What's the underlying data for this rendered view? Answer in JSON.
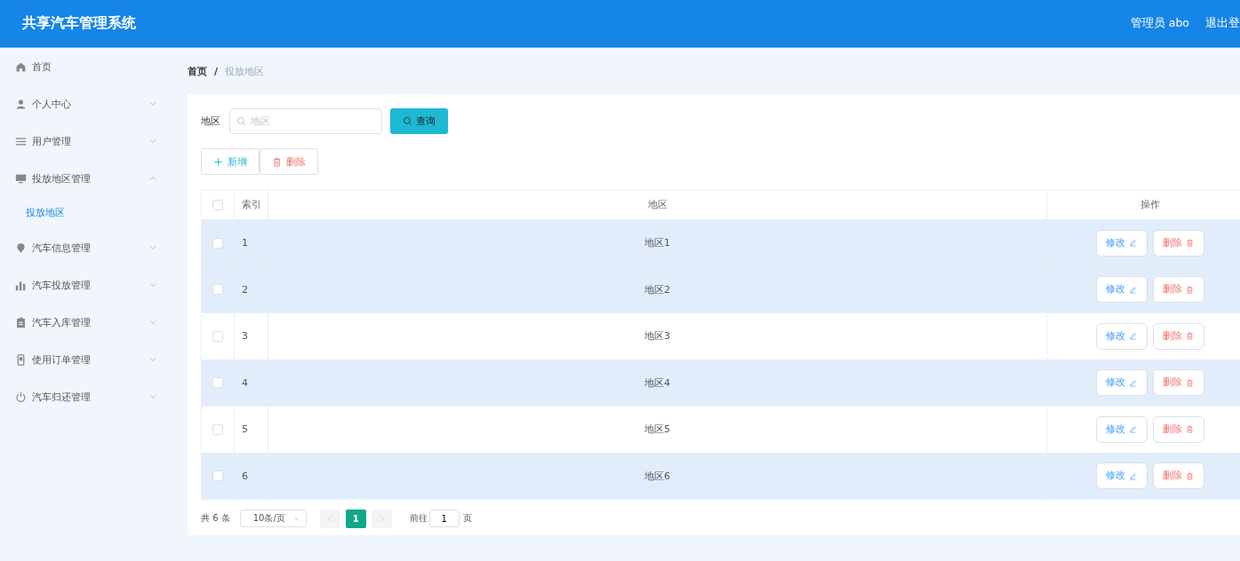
{
  "header": {
    "title": "共享汽车管理系统",
    "user": "管理员 abo",
    "logout": "退出登"
  },
  "sidebar": {
    "items": [
      {
        "label": "首页",
        "kind": "link"
      },
      {
        "label": "个人中心",
        "kind": "menu",
        "expanded": false
      },
      {
        "label": "用户管理",
        "kind": "menu",
        "expanded": false
      },
      {
        "label": "投放地区管理",
        "kind": "menu",
        "expanded": true,
        "children": [
          {
            "label": "投放地区",
            "selected": true
          }
        ]
      },
      {
        "label": "汽车信息管理",
        "kind": "menu",
        "expanded": false
      },
      {
        "label": "汽车投放管理",
        "kind": "menu",
        "expanded": false
      },
      {
        "label": "汽车入库管理",
        "kind": "menu",
        "expanded": false
      },
      {
        "label": "使用订单管理",
        "kind": "menu",
        "expanded": false
      },
      {
        "label": "汽车归还管理",
        "kind": "menu",
        "expanded": false
      }
    ]
  },
  "breadcrumb": {
    "separator": "/",
    "items": [
      "首页",
      "投放地区"
    ]
  },
  "search": {
    "label": "地区",
    "placeholder": "地区",
    "button": "查询"
  },
  "actions": [
    {
      "label": "新增",
      "kind": "add"
    },
    {
      "label": "删除",
      "kind": "delete"
    }
  ],
  "table": {
    "select_all_checked": false,
    "columns": [
      "索引",
      "地区",
      "操作"
    ],
    "rows": [
      {
        "index": "1",
        "region": "地区1",
        "checked": false,
        "highlighted": true,
        "actions": [
          {
            "label": "修改",
            "kind": "edit"
          },
          {
            "label": "删除",
            "kind": "delete"
          }
        ]
      },
      {
        "index": "2",
        "region": "地区2",
        "checked": false,
        "highlighted": true,
        "actions": [
          {
            "label": "修改",
            "kind": "edit"
          },
          {
            "label": "删除",
            "kind": "delete"
          }
        ]
      },
      {
        "index": "3",
        "region": "地区3",
        "checked": false,
        "highlighted": false,
        "actions": [
          {
            "label": "修改",
            "kind": "edit"
          },
          {
            "label": "删除",
            "kind": "delete"
          }
        ]
      },
      {
        "index": "4",
        "region": "地区4",
        "checked": false,
        "highlighted": true,
        "actions": [
          {
            "label": "修改",
            "kind": "edit"
          },
          {
            "label": "删除",
            "kind": "delete"
          }
        ]
      },
      {
        "index": "5",
        "region": "地区5",
        "checked": false,
        "highlighted": false,
        "actions": [
          {
            "label": "修改",
            "kind": "edit"
          },
          {
            "label": "删除",
            "kind": "delete"
          }
        ]
      },
      {
        "index": "6",
        "region": "地区6",
        "checked": false,
        "highlighted": true,
        "actions": [
          {
            "label": "修改",
            "kind": "edit"
          },
          {
            "label": "删除",
            "kind": "delete"
          }
        ]
      }
    ]
  },
  "pagination": {
    "total": "共 6 条",
    "page_size": "10条/页",
    "pages": [
      {
        "label": "1",
        "selected": true
      }
    ],
    "goto_label": "前往",
    "goto_value": "1",
    "page_unit": "页"
  }
}
